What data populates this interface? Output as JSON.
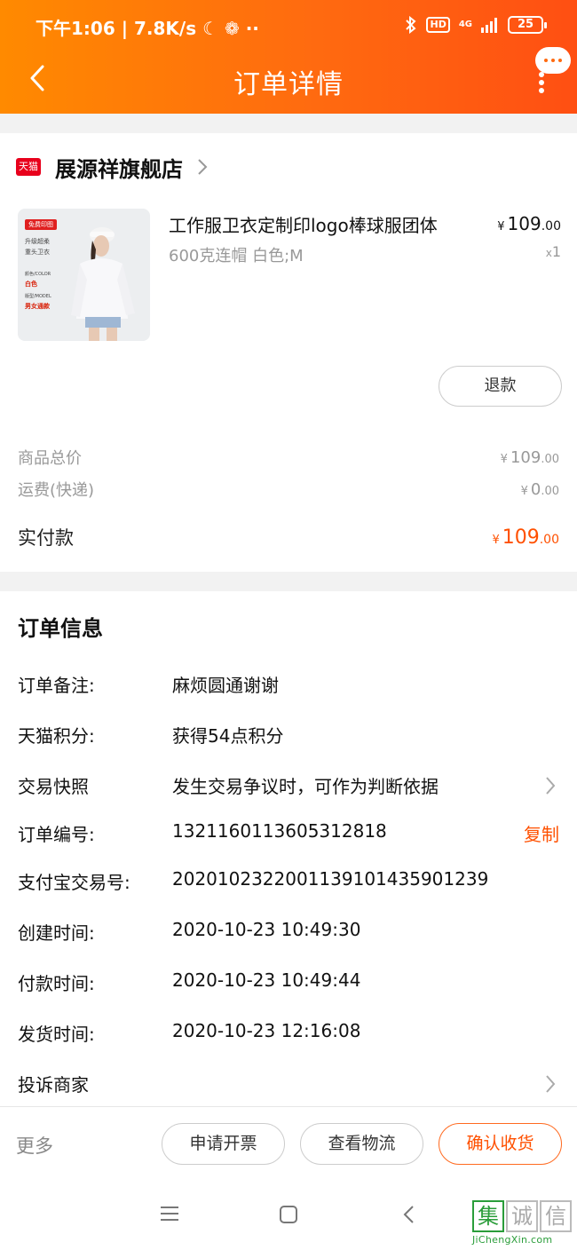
{
  "status_bar": {
    "left_text": "下午1:06 | 7.8K/s ☾ ❁ ··",
    "hd": "HD",
    "network": "4G",
    "battery": "25"
  },
  "header": {
    "title": "订单详情"
  },
  "shop": {
    "badge": "天猫",
    "name": "展源祥旗舰店"
  },
  "product": {
    "image_tag": "免费印图",
    "image_line1": "升级超柔",
    "image_line2": "重头卫衣",
    "image_line3": "颜色/COLOR",
    "image_red1": "白色",
    "image_line4": "版型/MODEL",
    "image_red2": "男女通款",
    "title": "工作服卫衣定制印logo棒球服团体",
    "spec": "600克连帽 白色;M",
    "price_yen": "¥",
    "price_int": "109",
    "price_dec": ".00",
    "qty_prefix": "x",
    "qty": "1",
    "refund_label": "退款"
  },
  "summary": {
    "goods_total_label": "商品总价",
    "goods_total_int": "109",
    "goods_total_dec": ".00",
    "shipping_label": "运费(快递)",
    "shipping_int": "0",
    "shipping_dec": ".00",
    "paid_label": "实付款",
    "paid_int": "109",
    "paid_dec": ".00",
    "yen": "¥"
  },
  "order_info": {
    "title": "订单信息",
    "rows": [
      {
        "label": "订单备注:",
        "value": "麻烦圆通谢谢"
      },
      {
        "label": "天猫积分:",
        "value": "获得54点积分"
      },
      {
        "label": "交易快照",
        "value": "发生交易争议时，可作为判断依据"
      },
      {
        "label": "订单编号:",
        "value": "1321160113605312818",
        "action": "复制"
      },
      {
        "label": "支付宝交易号:",
        "value": "2020102322001139101435901239"
      },
      {
        "label": "创建时间:",
        "value": "2020-10-23 10:49:30"
      },
      {
        "label": "付款时间:",
        "value": "2020-10-23 10:49:44"
      },
      {
        "label": "发货时间:",
        "value": "2020-10-23 12:16:08"
      },
      {
        "label": "投诉商家",
        "value": ""
      }
    ]
  },
  "bottom_bar": {
    "more": "更多",
    "invoice": "申请开票",
    "logistics": "查看物流",
    "confirm": "确认收货"
  },
  "watermark": {
    "char1": "集",
    "char2": "诚",
    "char3": "信",
    "url": "JiChengXin.com"
  },
  "colors": {
    "header_start": "#ff8a00",
    "header_end": "#ff4f12",
    "accent": "#ff5000",
    "tmall_red": "#e8001c"
  },
  "icons": [
    "back-arrow-icon",
    "more-dots-icon",
    "chat-bubble-icon",
    "chevron-right-icon",
    "menu-icon",
    "home-square-icon",
    "back-triangle-icon"
  ]
}
